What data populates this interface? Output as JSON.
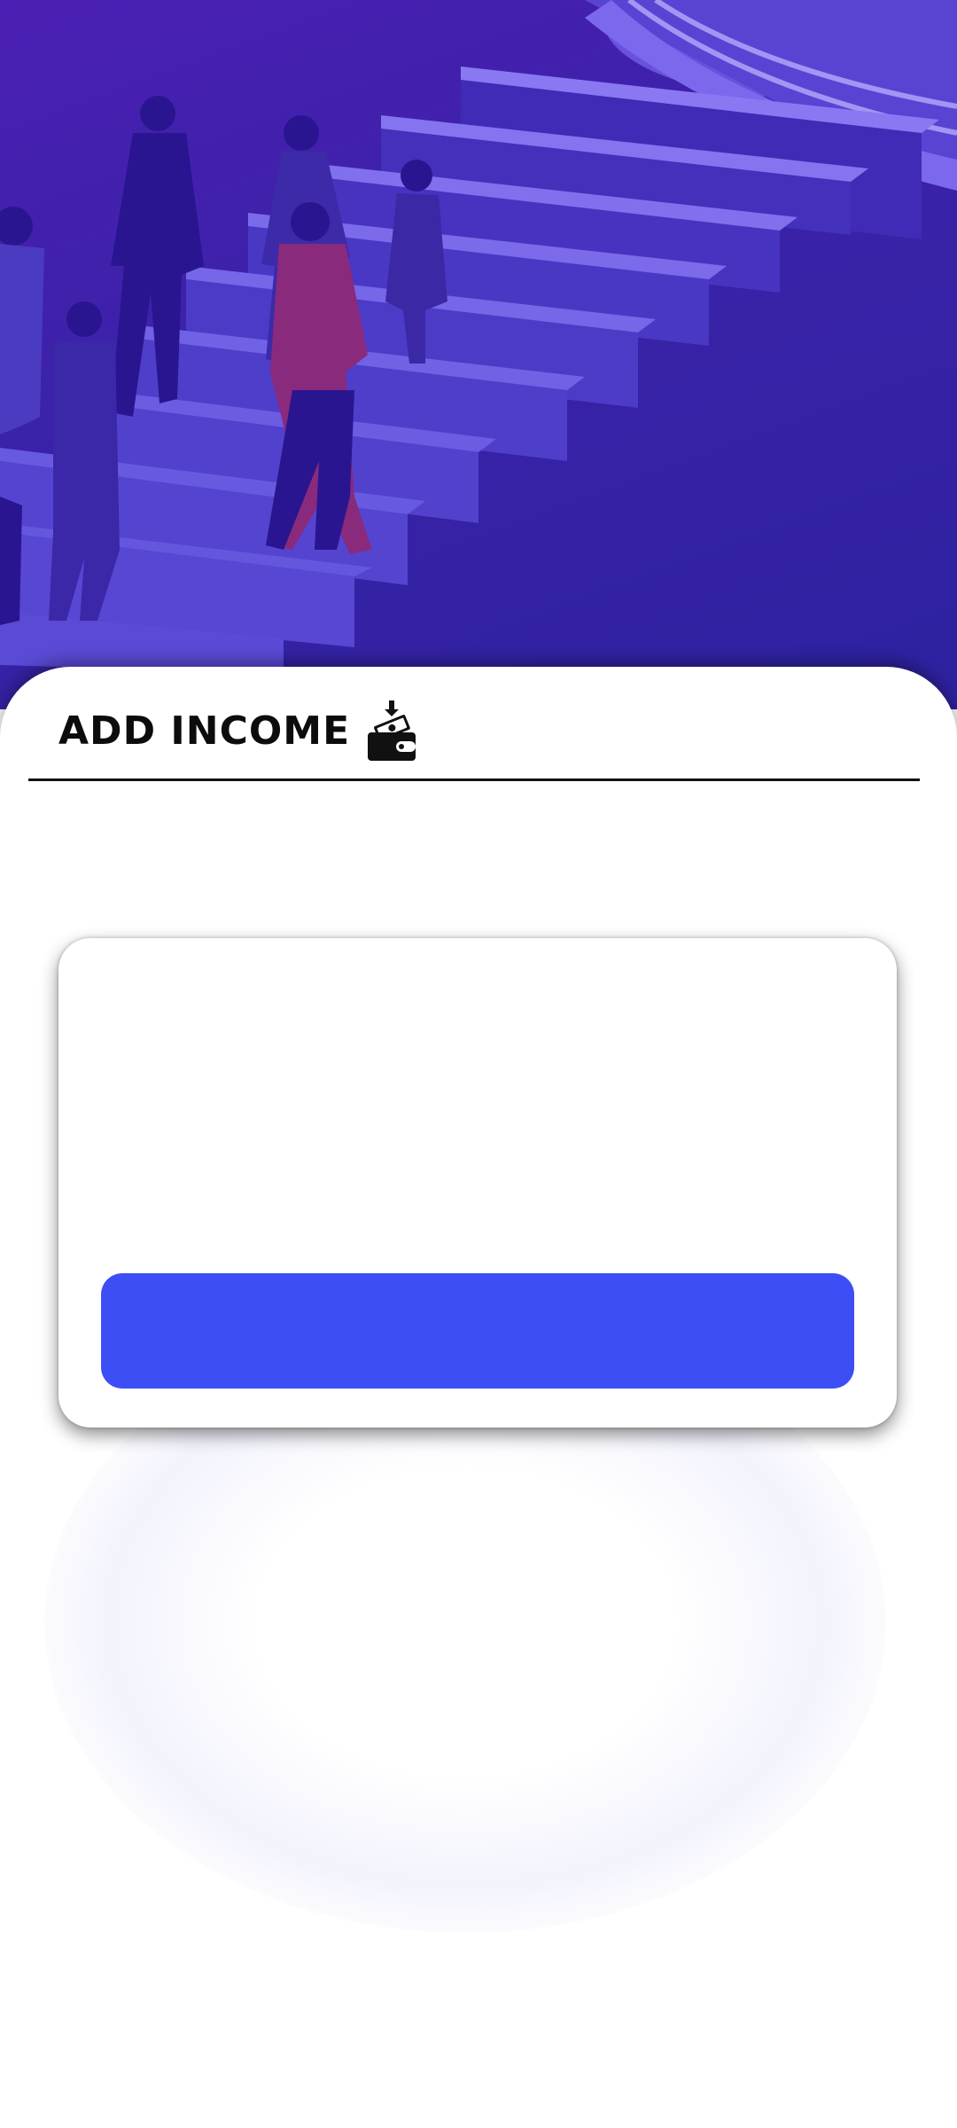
{
  "header": {
    "title": "ADD INCOME",
    "icon": "wallet-income-icon"
  },
  "form_card": {
    "submit_label": ""
  },
  "illustration": {
    "name": "people-climbing-money-stairs"
  },
  "colors": {
    "hero_background": "#3a22a8",
    "button": "#3d4ef5",
    "title_text": "#0c0c0c"
  }
}
